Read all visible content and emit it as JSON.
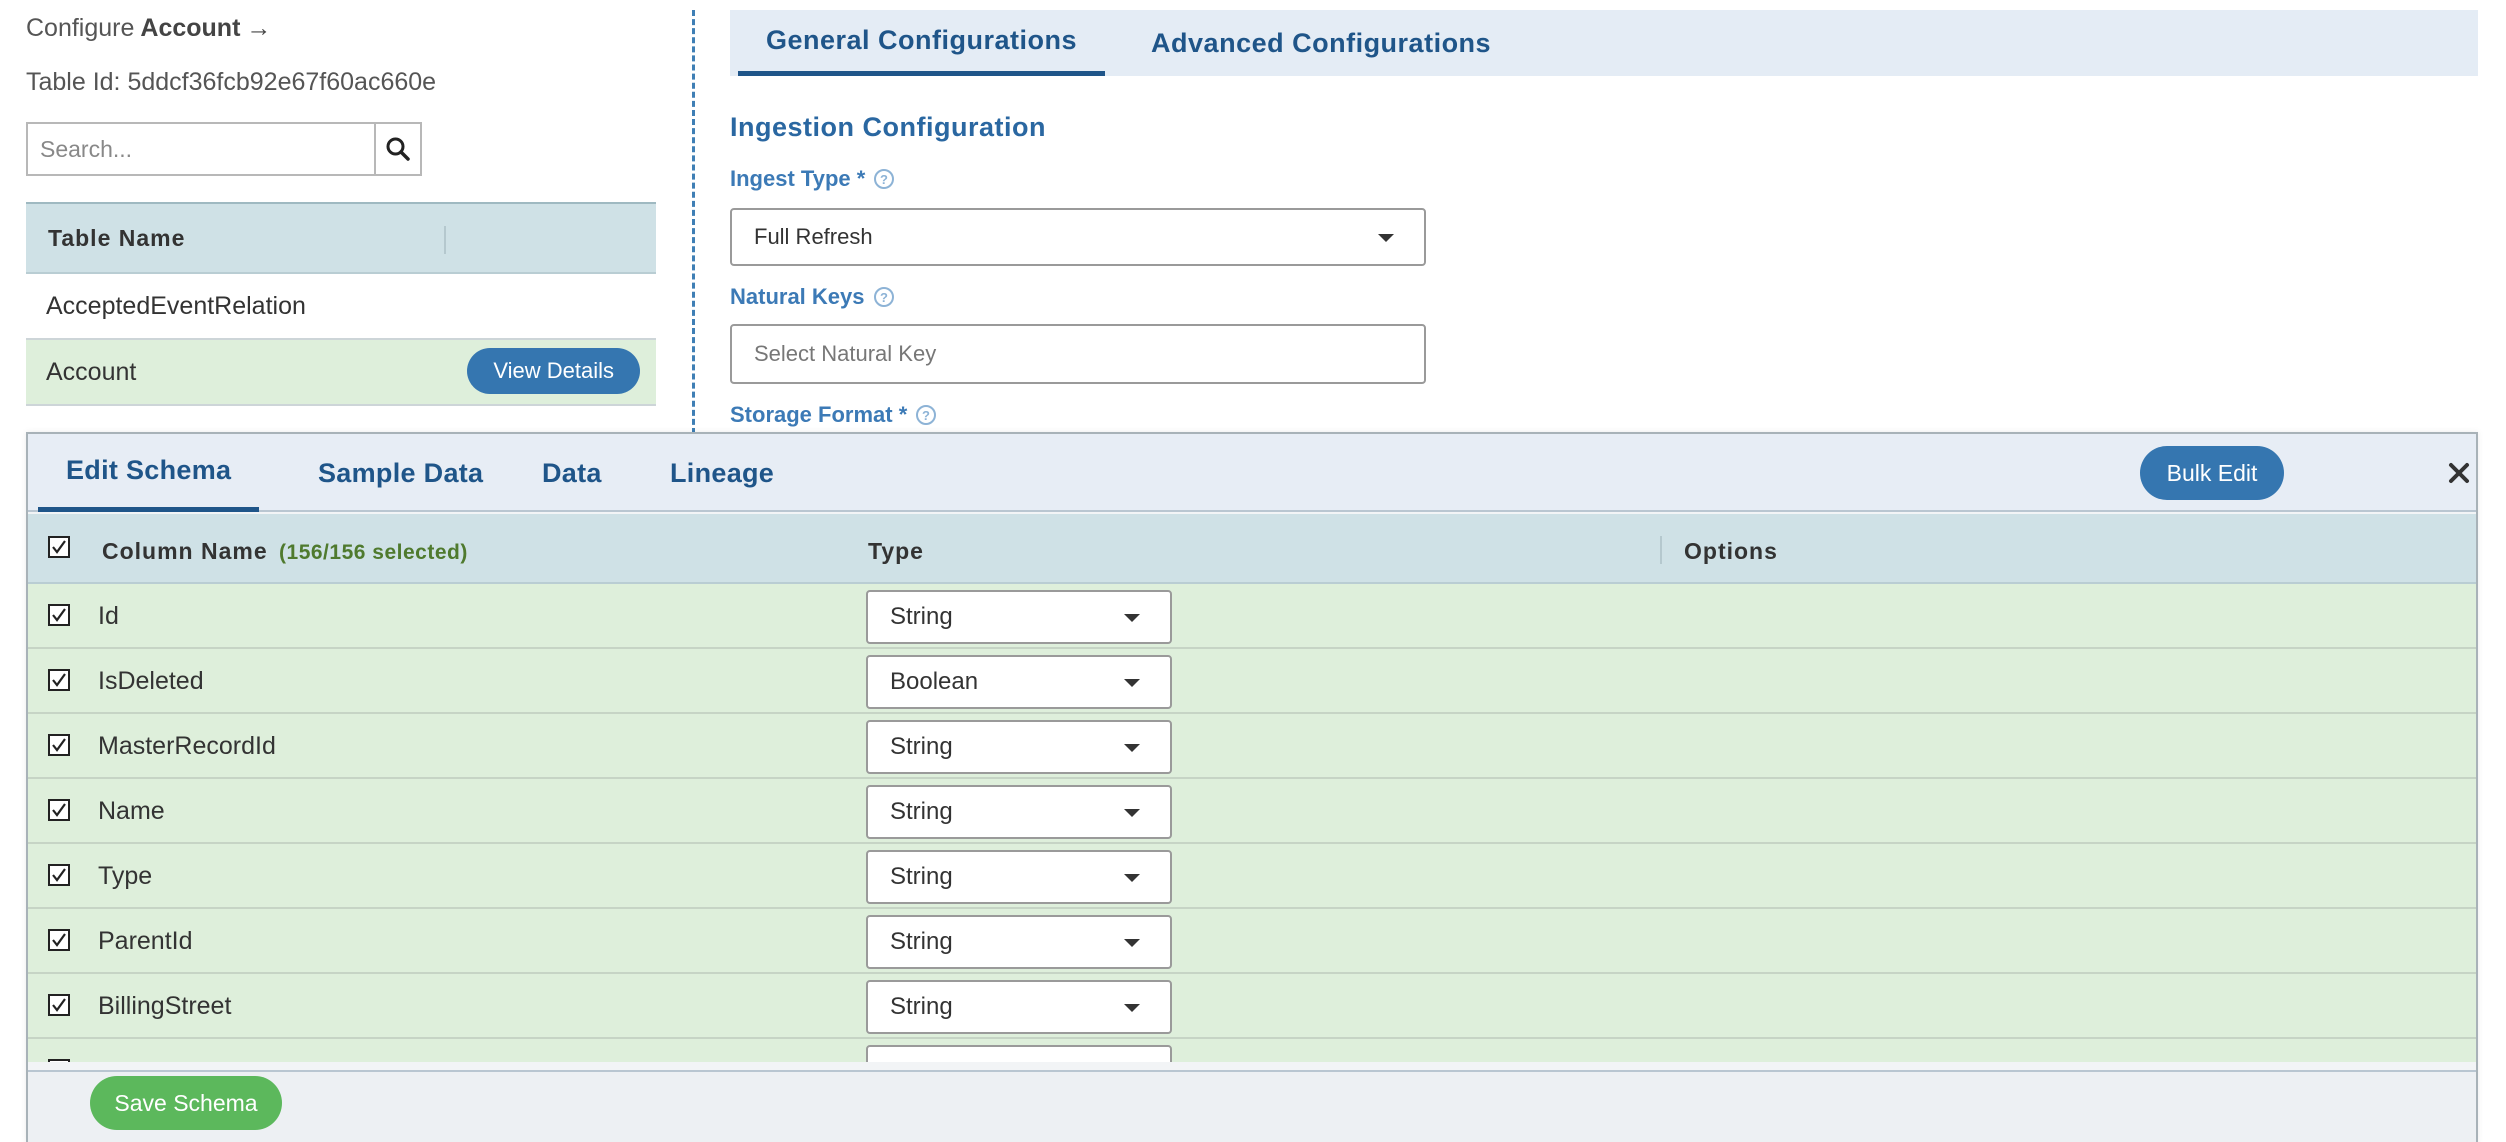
{
  "left_panel": {
    "configure_prefix": "Configure",
    "table_name": "Account",
    "arrow_symbol": "→",
    "table_id": "Table Id: 5ddcf36fcb92e67f60ac660e",
    "search": {
      "placeholder": "Search...",
      "value": "",
      "icon": "search-icon"
    },
    "table_list": {
      "header": "Table Name",
      "rows": [
        {
          "name": "AcceptedEventRelation",
          "selected": false
        },
        {
          "name": "Account",
          "selected": true,
          "action_label": "View Details"
        }
      ]
    }
  },
  "config": {
    "tabs": [
      {
        "label": "General Configurations",
        "active": true
      },
      {
        "label": "Advanced Configurations",
        "active": false
      }
    ],
    "section_title": "Ingestion Configuration",
    "ingest_type": {
      "label": "Ingest Type *",
      "value": "Full Refresh",
      "icon": "help-circle-icon"
    },
    "natural_keys": {
      "label": "Natural Keys",
      "placeholder": "Select Natural Key",
      "icon": "help-circle-icon"
    },
    "storage_format": {
      "label": "Storage Format *",
      "icon": "help-circle-icon"
    }
  },
  "schema_modal": {
    "tabs": [
      {
        "label": "Edit Schema",
        "active": true
      },
      {
        "label": "Sample Data",
        "active": false
      },
      {
        "label": "Data",
        "active": false
      },
      {
        "label": "Lineage",
        "active": false
      }
    ],
    "bulk_edit_label": "Bulk Edit",
    "close_icon": "close-icon",
    "columns": {
      "name_header": "Column Name",
      "selected_count": "(156/156 selected)",
      "type_header": "Type",
      "options_header": "Options"
    },
    "rows": [
      {
        "name": "Id",
        "type": "String",
        "checked": true
      },
      {
        "name": "IsDeleted",
        "type": "Boolean",
        "checked": true
      },
      {
        "name": "MasterRecordId",
        "type": "String",
        "checked": true
      },
      {
        "name": "Name",
        "type": "String",
        "checked": true
      },
      {
        "name": "Type",
        "type": "String",
        "checked": true
      },
      {
        "name": "ParentId",
        "type": "String",
        "checked": true
      },
      {
        "name": "BillingStreet",
        "type": "String",
        "checked": true
      }
    ],
    "save_label": "Save Schema"
  },
  "colors": {
    "primary_blue": "#3576b0",
    "tab_text_blue": "#1f5589",
    "row_selected_green": "#deefdb",
    "header_teal": "#cfe1e6",
    "save_green": "#5cb85c"
  }
}
